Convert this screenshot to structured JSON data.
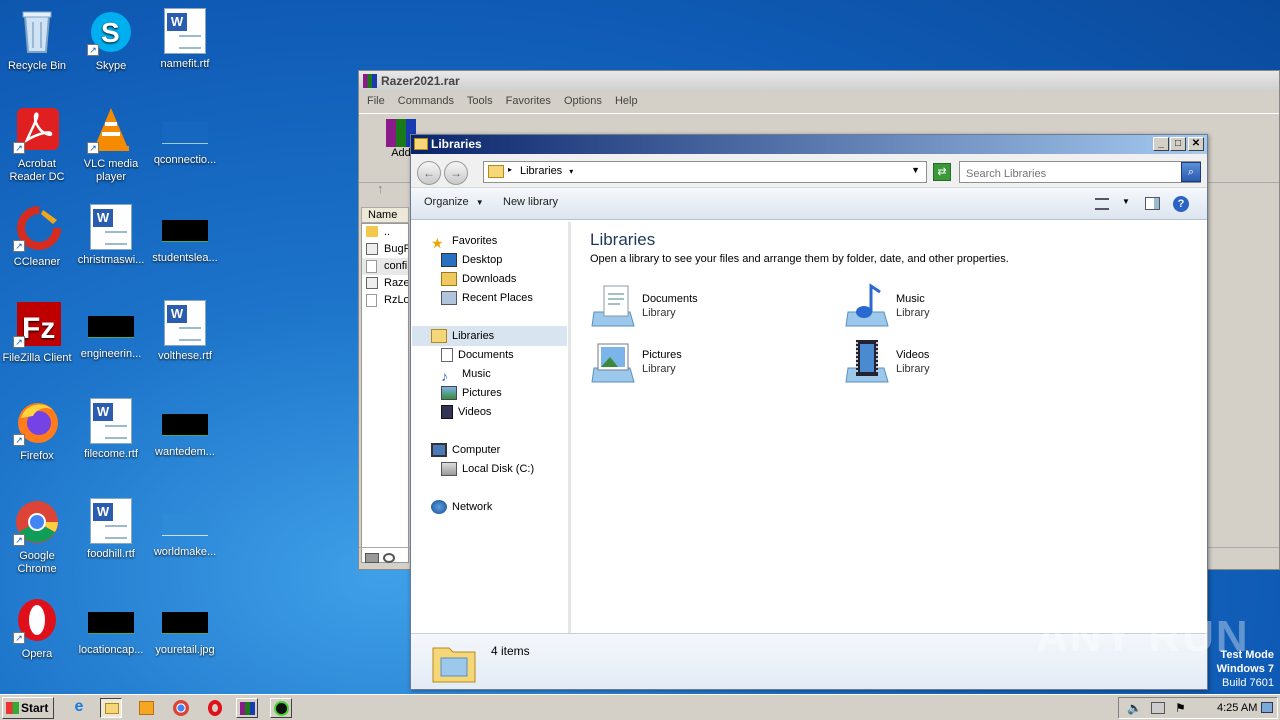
{
  "desktop": {
    "icons": [
      {
        "label": "Recycle Bin"
      },
      {
        "label": "Skype"
      },
      {
        "label": "namefit.rtf"
      },
      {
        "label": "Acrobat Reader DC"
      },
      {
        "label": "VLC media player"
      },
      {
        "label": "qconnectio..."
      },
      {
        "label": "CCleaner"
      },
      {
        "label": "christmaswi..."
      },
      {
        "label": "studentslea..."
      },
      {
        "label": "FileZilla Client"
      },
      {
        "label": "engineerin..."
      },
      {
        "label": "volthese.rtf"
      },
      {
        "label": "Firefox"
      },
      {
        "label": "filecome.rtf"
      },
      {
        "label": "wantedem..."
      },
      {
        "label": "Google Chrome"
      },
      {
        "label": "foodhill.rtf"
      },
      {
        "label": "worldmake..."
      },
      {
        "label": "Opera"
      },
      {
        "label": "locationcap..."
      },
      {
        "label": "youretail.jpg"
      }
    ]
  },
  "winrar": {
    "title": "Razer2021.rar",
    "menu": [
      "File",
      "Commands",
      "Tools",
      "Favorites",
      "Options",
      "Help"
    ],
    "add_label": "Add",
    "column_name": "Name",
    "files": [
      "..",
      "BugR",
      "confi",
      "Raze",
      "RzLo"
    ]
  },
  "explorer": {
    "title": "Libraries",
    "address": "Libraries",
    "search_placeholder": "Search Libraries",
    "organize": "Organize",
    "new_library": "New library",
    "nav": {
      "favorites": "Favorites",
      "desktop": "Desktop",
      "downloads": "Downloads",
      "recent": "Recent Places",
      "libraries": "Libraries",
      "documents": "Documents",
      "music": "Music",
      "pictures": "Pictures",
      "videos": "Videos",
      "computer": "Computer",
      "local_disk": "Local Disk (C:)",
      "network": "Network"
    },
    "heading": "Libraries",
    "subheading": "Open a library to see your files and arrange them by folder, date, and other properties.",
    "libraries": [
      {
        "name": "Documents",
        "type": "Library"
      },
      {
        "name": "Music",
        "type": "Library"
      },
      {
        "name": "Pictures",
        "type": "Library"
      },
      {
        "name": "Videos",
        "type": "Library"
      }
    ],
    "item_count": "4 items"
  },
  "taskbar": {
    "start": "Start",
    "clock": "4:25 AM"
  },
  "watermark": {
    "line1": "Test Mode",
    "line2": "Windows 7",
    "line3": "Build 7601",
    "brand": "ANY RUN"
  },
  "colors": {
    "desktop_blue": "#1c73c9",
    "title_active": "#0a246a",
    "classic_face": "#d4d0c8"
  }
}
